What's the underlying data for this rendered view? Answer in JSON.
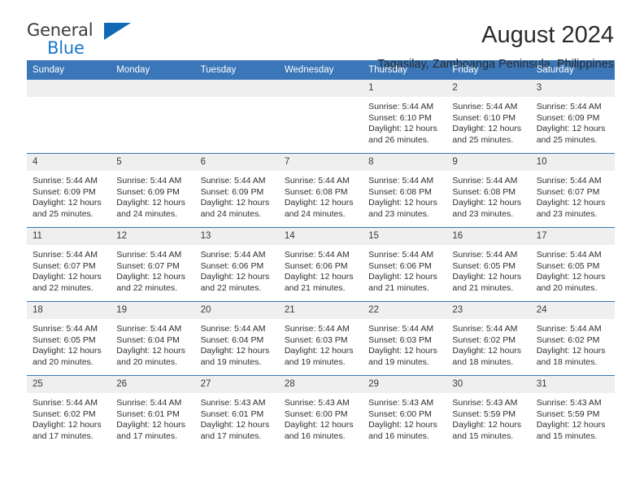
{
  "brand": {
    "name_part1": "General",
    "name_part2": "Blue",
    "accent_color": "#1069b4",
    "header_color": "#3a76b8"
  },
  "header": {
    "title": "August 2024",
    "subtitle": "Tagasilay, Zamboanga Peninsula, Philippines"
  },
  "calendar": {
    "weekday_headers": [
      "Sunday",
      "Monday",
      "Tuesday",
      "Wednesday",
      "Thursday",
      "Friday",
      "Saturday"
    ],
    "weeks": [
      [
        {
          "day": "",
          "sunrise": "",
          "sunset": "",
          "daylight": ""
        },
        {
          "day": "",
          "sunrise": "",
          "sunset": "",
          "daylight": ""
        },
        {
          "day": "",
          "sunrise": "",
          "sunset": "",
          "daylight": ""
        },
        {
          "day": "",
          "sunrise": "",
          "sunset": "",
          "daylight": ""
        },
        {
          "day": "1",
          "sunrise": "Sunrise: 5:44 AM",
          "sunset": "Sunset: 6:10 PM",
          "daylight": "Daylight: 12 hours and 26 minutes."
        },
        {
          "day": "2",
          "sunrise": "Sunrise: 5:44 AM",
          "sunset": "Sunset: 6:10 PM",
          "daylight": "Daylight: 12 hours and 25 minutes."
        },
        {
          "day": "3",
          "sunrise": "Sunrise: 5:44 AM",
          "sunset": "Sunset: 6:09 PM",
          "daylight": "Daylight: 12 hours and 25 minutes."
        }
      ],
      [
        {
          "day": "4",
          "sunrise": "Sunrise: 5:44 AM",
          "sunset": "Sunset: 6:09 PM",
          "daylight": "Daylight: 12 hours and 25 minutes."
        },
        {
          "day": "5",
          "sunrise": "Sunrise: 5:44 AM",
          "sunset": "Sunset: 6:09 PM",
          "daylight": "Daylight: 12 hours and 24 minutes."
        },
        {
          "day": "6",
          "sunrise": "Sunrise: 5:44 AM",
          "sunset": "Sunset: 6:09 PM",
          "daylight": "Daylight: 12 hours and 24 minutes."
        },
        {
          "day": "7",
          "sunrise": "Sunrise: 5:44 AM",
          "sunset": "Sunset: 6:08 PM",
          "daylight": "Daylight: 12 hours and 24 minutes."
        },
        {
          "day": "8",
          "sunrise": "Sunrise: 5:44 AM",
          "sunset": "Sunset: 6:08 PM",
          "daylight": "Daylight: 12 hours and 23 minutes."
        },
        {
          "day": "9",
          "sunrise": "Sunrise: 5:44 AM",
          "sunset": "Sunset: 6:08 PM",
          "daylight": "Daylight: 12 hours and 23 minutes."
        },
        {
          "day": "10",
          "sunrise": "Sunrise: 5:44 AM",
          "sunset": "Sunset: 6:07 PM",
          "daylight": "Daylight: 12 hours and 23 minutes."
        }
      ],
      [
        {
          "day": "11",
          "sunrise": "Sunrise: 5:44 AM",
          "sunset": "Sunset: 6:07 PM",
          "daylight": "Daylight: 12 hours and 22 minutes."
        },
        {
          "day": "12",
          "sunrise": "Sunrise: 5:44 AM",
          "sunset": "Sunset: 6:07 PM",
          "daylight": "Daylight: 12 hours and 22 minutes."
        },
        {
          "day": "13",
          "sunrise": "Sunrise: 5:44 AM",
          "sunset": "Sunset: 6:06 PM",
          "daylight": "Daylight: 12 hours and 22 minutes."
        },
        {
          "day": "14",
          "sunrise": "Sunrise: 5:44 AM",
          "sunset": "Sunset: 6:06 PM",
          "daylight": "Daylight: 12 hours and 21 minutes."
        },
        {
          "day": "15",
          "sunrise": "Sunrise: 5:44 AM",
          "sunset": "Sunset: 6:06 PM",
          "daylight": "Daylight: 12 hours and 21 minutes."
        },
        {
          "day": "16",
          "sunrise": "Sunrise: 5:44 AM",
          "sunset": "Sunset: 6:05 PM",
          "daylight": "Daylight: 12 hours and 21 minutes."
        },
        {
          "day": "17",
          "sunrise": "Sunrise: 5:44 AM",
          "sunset": "Sunset: 6:05 PM",
          "daylight": "Daylight: 12 hours and 20 minutes."
        }
      ],
      [
        {
          "day": "18",
          "sunrise": "Sunrise: 5:44 AM",
          "sunset": "Sunset: 6:05 PM",
          "daylight": "Daylight: 12 hours and 20 minutes."
        },
        {
          "day": "19",
          "sunrise": "Sunrise: 5:44 AM",
          "sunset": "Sunset: 6:04 PM",
          "daylight": "Daylight: 12 hours and 20 minutes."
        },
        {
          "day": "20",
          "sunrise": "Sunrise: 5:44 AM",
          "sunset": "Sunset: 6:04 PM",
          "daylight": "Daylight: 12 hours and 19 minutes."
        },
        {
          "day": "21",
          "sunrise": "Sunrise: 5:44 AM",
          "sunset": "Sunset: 6:03 PM",
          "daylight": "Daylight: 12 hours and 19 minutes."
        },
        {
          "day": "22",
          "sunrise": "Sunrise: 5:44 AM",
          "sunset": "Sunset: 6:03 PM",
          "daylight": "Daylight: 12 hours and 19 minutes."
        },
        {
          "day": "23",
          "sunrise": "Sunrise: 5:44 AM",
          "sunset": "Sunset: 6:02 PM",
          "daylight": "Daylight: 12 hours and 18 minutes."
        },
        {
          "day": "24",
          "sunrise": "Sunrise: 5:44 AM",
          "sunset": "Sunset: 6:02 PM",
          "daylight": "Daylight: 12 hours and 18 minutes."
        }
      ],
      [
        {
          "day": "25",
          "sunrise": "Sunrise: 5:44 AM",
          "sunset": "Sunset: 6:02 PM",
          "daylight": "Daylight: 12 hours and 17 minutes."
        },
        {
          "day": "26",
          "sunrise": "Sunrise: 5:44 AM",
          "sunset": "Sunset: 6:01 PM",
          "daylight": "Daylight: 12 hours and 17 minutes."
        },
        {
          "day": "27",
          "sunrise": "Sunrise: 5:43 AM",
          "sunset": "Sunset: 6:01 PM",
          "daylight": "Daylight: 12 hours and 17 minutes."
        },
        {
          "day": "28",
          "sunrise": "Sunrise: 5:43 AM",
          "sunset": "Sunset: 6:00 PM",
          "daylight": "Daylight: 12 hours and 16 minutes."
        },
        {
          "day": "29",
          "sunrise": "Sunrise: 5:43 AM",
          "sunset": "Sunset: 6:00 PM",
          "daylight": "Daylight: 12 hours and 16 minutes."
        },
        {
          "day": "30",
          "sunrise": "Sunrise: 5:43 AM",
          "sunset": "Sunset: 5:59 PM",
          "daylight": "Daylight: 12 hours and 15 minutes."
        },
        {
          "day": "31",
          "sunrise": "Sunrise: 5:43 AM",
          "sunset": "Sunset: 5:59 PM",
          "daylight": "Daylight: 12 hours and 15 minutes."
        }
      ]
    ]
  }
}
